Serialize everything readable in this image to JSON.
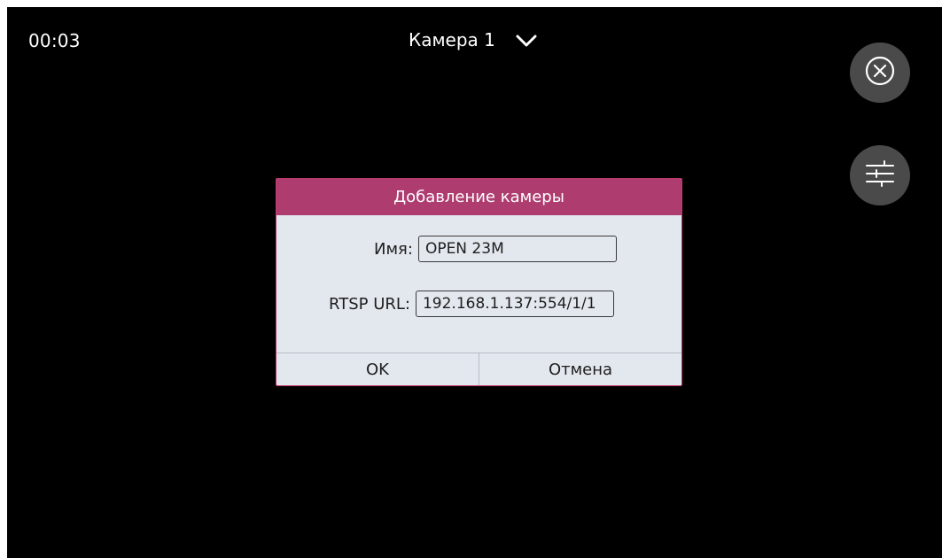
{
  "status": {
    "time": "00:03"
  },
  "header": {
    "camera_name": "Камера 1",
    "dropdown_icon": "chevron-down-icon"
  },
  "side_buttons": {
    "close_icon": "close-circle-icon",
    "settings_icon": "sliders-icon"
  },
  "dialog": {
    "title": "Добавление камеры",
    "name_label": "Имя:",
    "name_value": "OPEN 23M",
    "url_label": "RTSP URL:",
    "url_value": "192.168.1.137:554/1/1",
    "ok_label": "OK",
    "cancel_label": "Отмена"
  },
  "colors": {
    "background": "#000000",
    "dialog_header": "#ae3c6f",
    "dialog_body": "#e3e7ee",
    "round_button": "#4a4a4a"
  }
}
